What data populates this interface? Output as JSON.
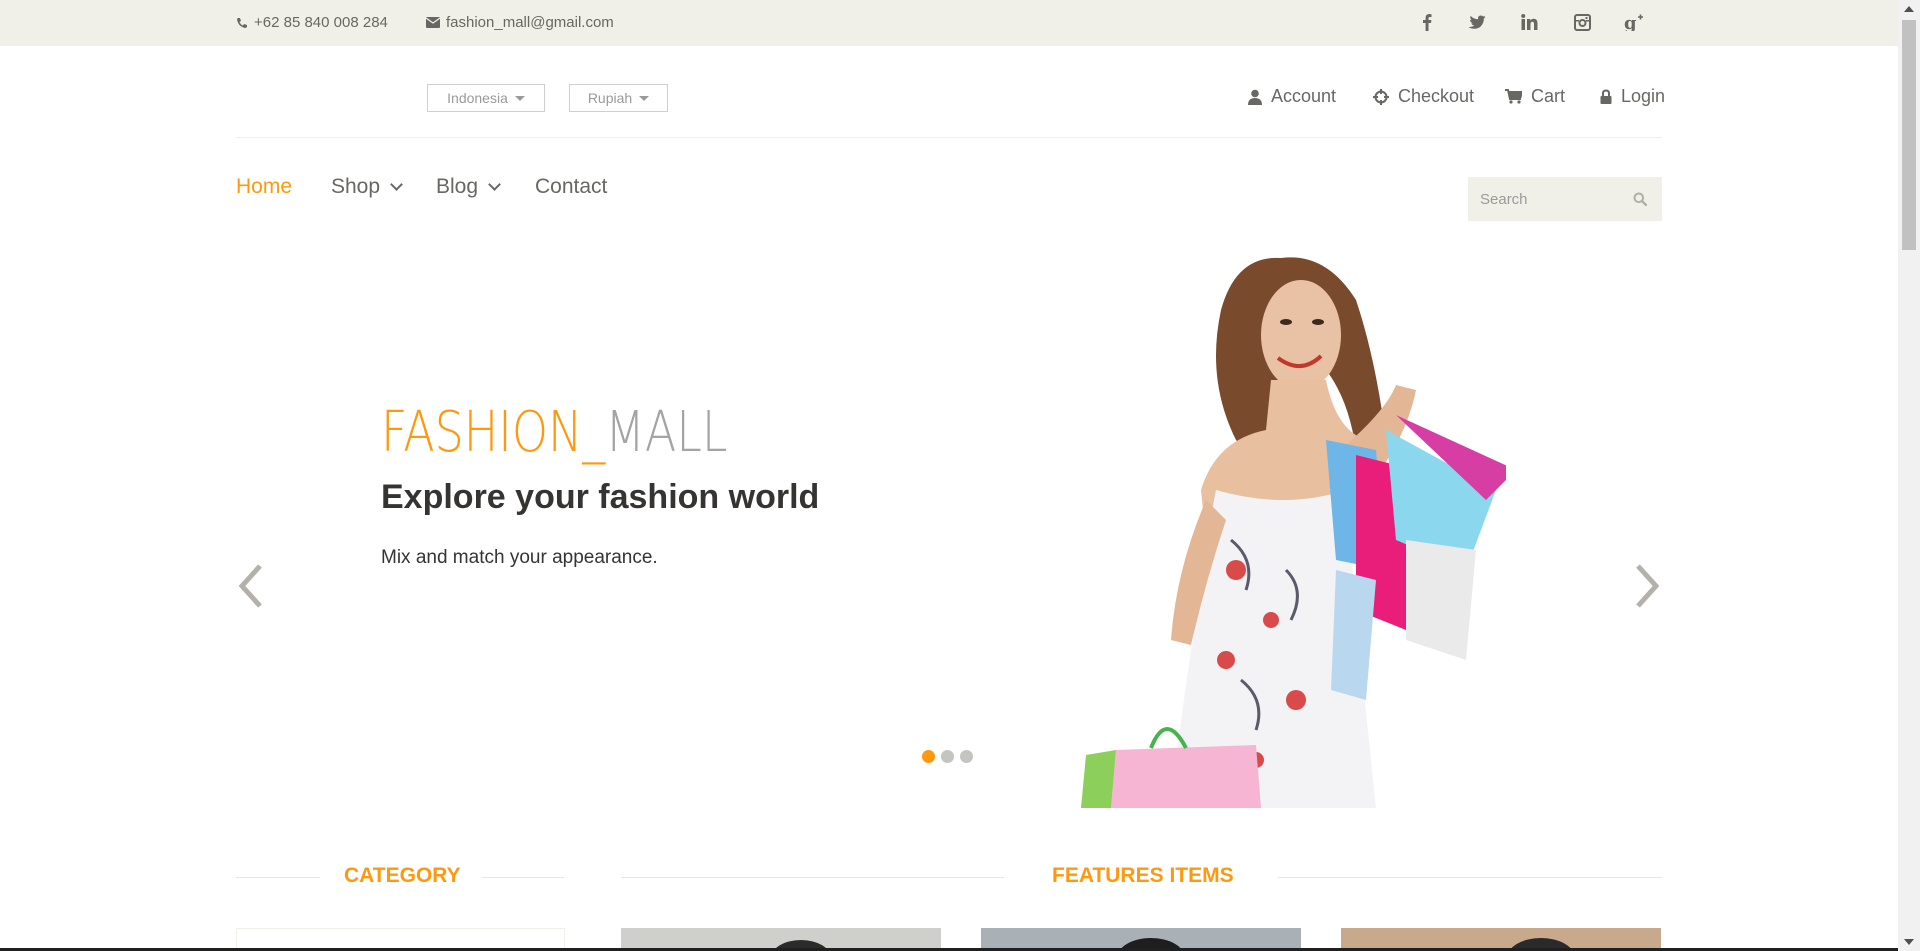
{
  "topbar": {
    "phone": "+62 85 840 008 284",
    "email": "fashion_mall@gmail.com",
    "social": [
      {
        "icon": "facebook-icon",
        "glyph": "f"
      },
      {
        "icon": "twitter-icon",
        "glyph": "t"
      },
      {
        "icon": "linkedin-icon",
        "glyph": "in"
      },
      {
        "icon": "instagram-icon",
        "glyph": "ig"
      },
      {
        "icon": "google-plus-icon",
        "glyph": "g+"
      }
    ]
  },
  "header": {
    "language": "Indonesia",
    "currency": "Rupiah",
    "links": {
      "account": "Account",
      "checkout": "Checkout",
      "cart": "Cart",
      "login": "Login"
    }
  },
  "nav": {
    "home": "Home",
    "shop": "Shop",
    "blog": "Blog",
    "contact": "Contact",
    "search_placeholder": "Search"
  },
  "slider": {
    "brand_part1": "FASHION_",
    "brand_part2": "MALL",
    "headline": "Explore your fashion world",
    "tagline": "Mix and match your appearance.",
    "slide_count": 3,
    "active_slide": 1
  },
  "sections": {
    "category": "CATEGORY",
    "features": "FEATURES ITEMS"
  },
  "colors": {
    "accent": "#fe980f",
    "topbar_bg": "#f0f0e9",
    "text": "#696763",
    "dark_text": "#363432"
  }
}
